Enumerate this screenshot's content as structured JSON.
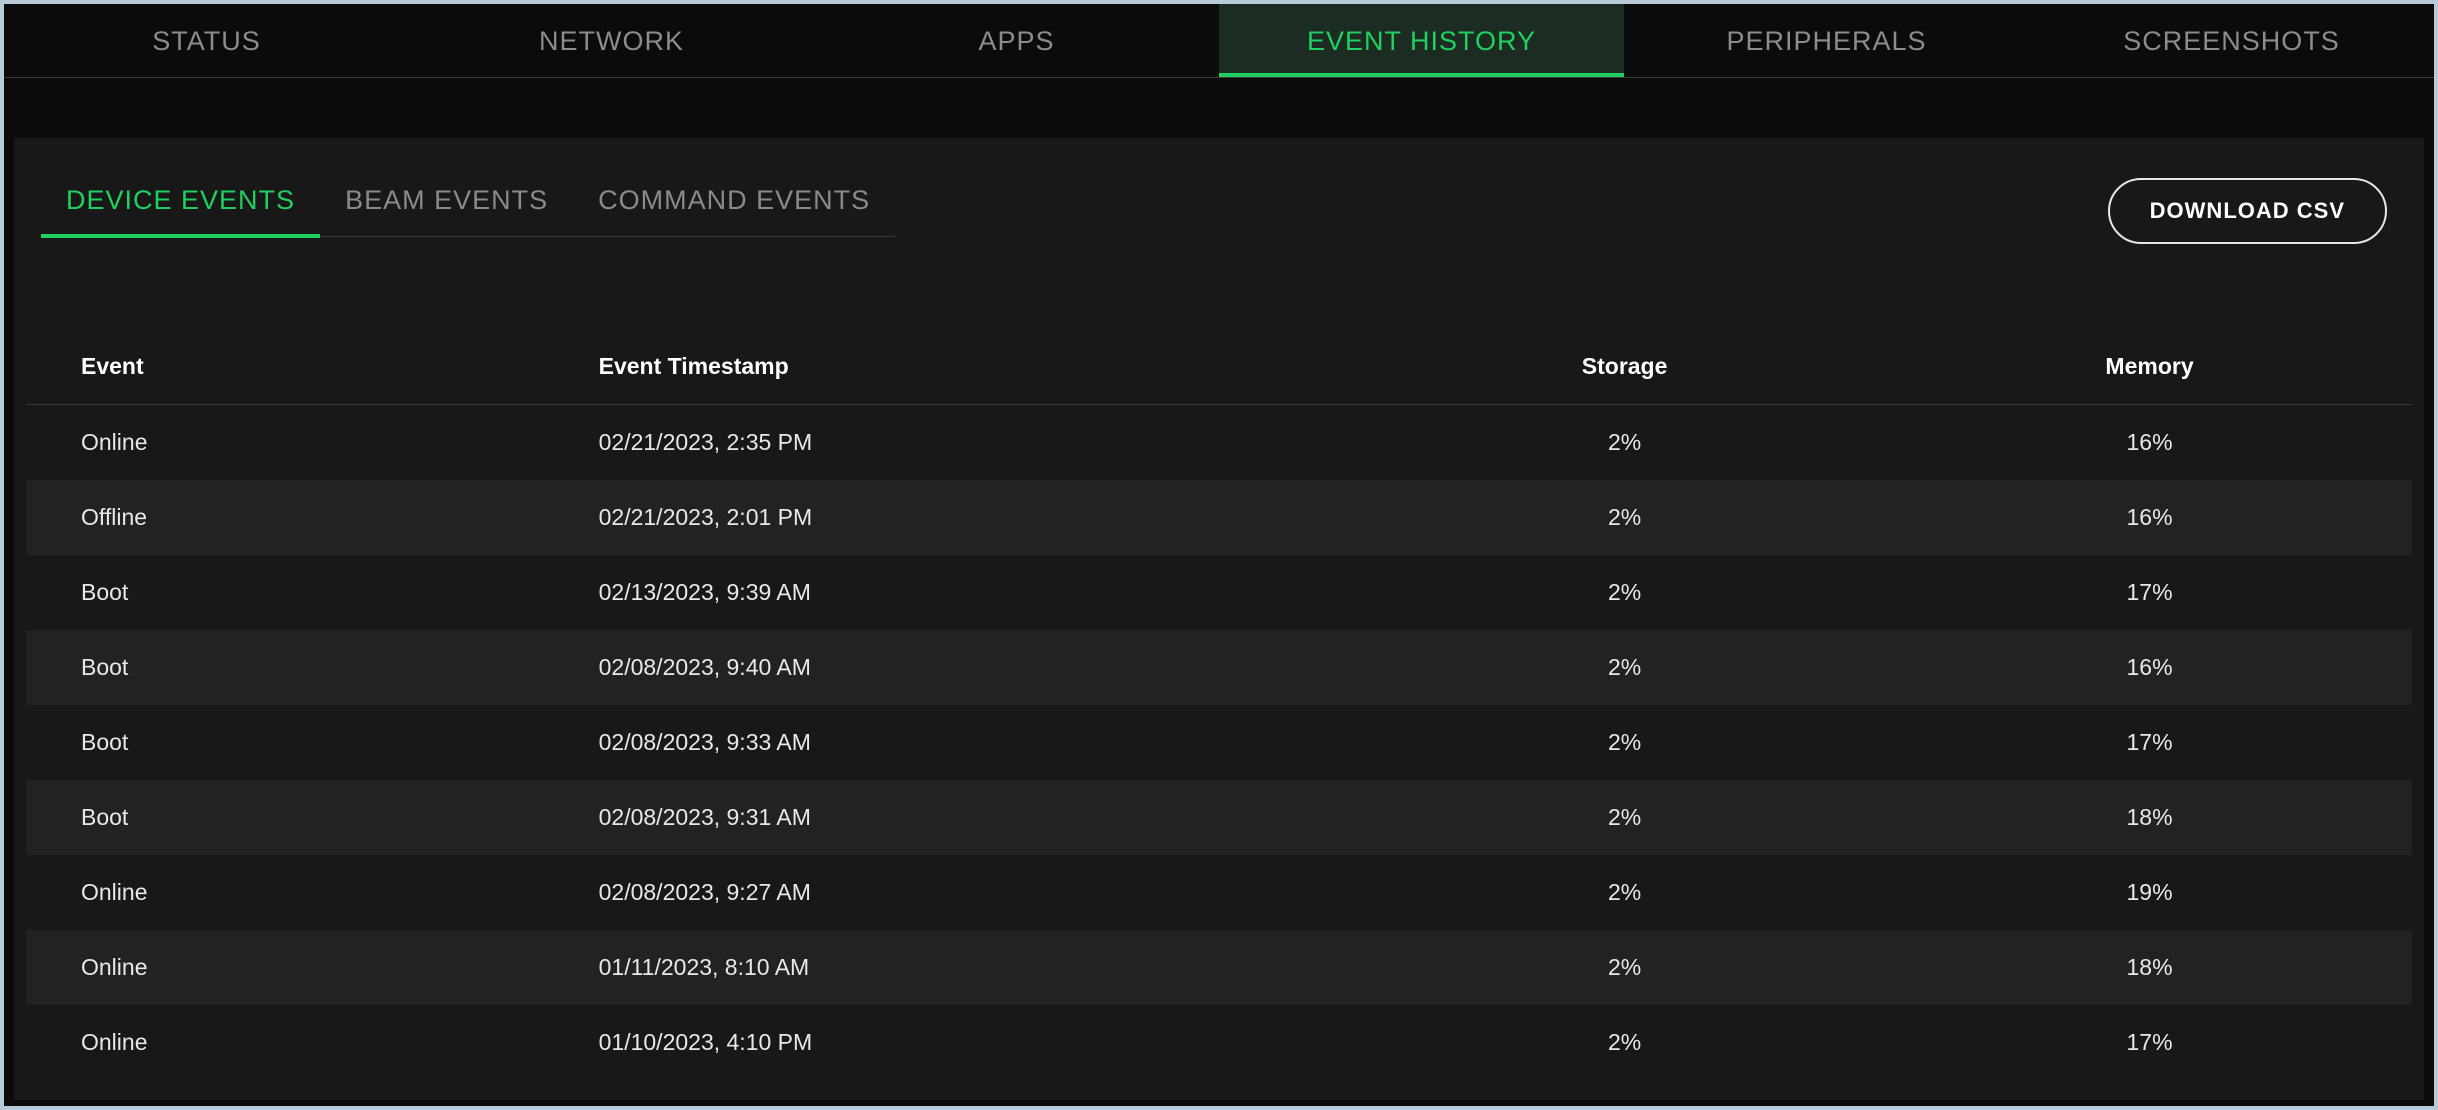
{
  "top_tabs": [
    {
      "label": "STATUS",
      "active": false
    },
    {
      "label": "NETWORK",
      "active": false
    },
    {
      "label": "APPS",
      "active": false
    },
    {
      "label": "EVENT HISTORY",
      "active": true
    },
    {
      "label": "PERIPHERALS",
      "active": false
    },
    {
      "label": "SCREENSHOTS",
      "active": false
    }
  ],
  "sub_tabs": [
    {
      "label": "DEVICE EVENTS",
      "active": true
    },
    {
      "label": "BEAM EVENTS",
      "active": false
    },
    {
      "label": "COMMAND EVENTS",
      "active": false
    }
  ],
  "download_button_label": "DOWNLOAD CSV",
  "columns": {
    "event": "Event",
    "timestamp": "Event Timestamp",
    "storage": "Storage",
    "memory": "Memory"
  },
  "rows": [
    {
      "event": "Online",
      "timestamp": "02/21/2023, 2:35 PM",
      "storage": "2%",
      "memory": "16%"
    },
    {
      "event": "Offline",
      "timestamp": "02/21/2023, 2:01 PM",
      "storage": "2%",
      "memory": "16%"
    },
    {
      "event": "Boot",
      "timestamp": "02/13/2023, 9:39 AM",
      "storage": "2%",
      "memory": "17%"
    },
    {
      "event": "Boot",
      "timestamp": "02/08/2023, 9:40 AM",
      "storage": "2%",
      "memory": "16%"
    },
    {
      "event": "Boot",
      "timestamp": "02/08/2023, 9:33 AM",
      "storage": "2%",
      "memory": "17%"
    },
    {
      "event": "Boot",
      "timestamp": "02/08/2023, 9:31 AM",
      "storage": "2%",
      "memory": "18%"
    },
    {
      "event": "Online",
      "timestamp": "02/08/2023, 9:27 AM",
      "storage": "2%",
      "memory": "19%"
    },
    {
      "event": "Online",
      "timestamp": "01/11/2023, 8:10 AM",
      "storage": "2%",
      "memory": "18%"
    },
    {
      "event": "Online",
      "timestamp": "01/10/2023, 4:10 PM",
      "storage": "2%",
      "memory": "17%"
    }
  ]
}
